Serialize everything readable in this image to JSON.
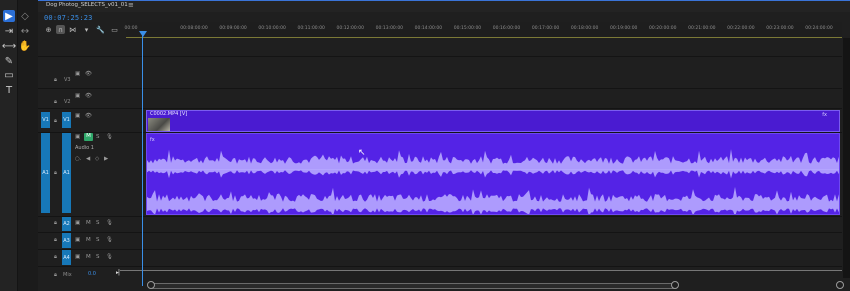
{
  "sequence_tab": {
    "title": "Dog Photog_SELECTS_v01_01",
    "menu_icon": "hamburger-menu-icon"
  },
  "timecode": "00:07:25:23",
  "ruler": {
    "ticks": [
      "00:00",
      "00:08:00:00",
      "00:09:00:00",
      "00:10:00:00",
      "00:11:00:00",
      "00:12:00:00",
      "00:13:00:00",
      "00:14:00:00",
      "00:15:00:00",
      "00:16:00:00",
      "00:17:00:00",
      "00:18:00:00",
      "00:19:00:00",
      "00:20:00:00",
      "00:21:00:00",
      "00:22:00:00",
      "00:23:00:00",
      "00:24:00:00"
    ]
  },
  "tracks": {
    "v3": {
      "label": "V3"
    },
    "v2": {
      "label": "V2"
    },
    "v1": {
      "label": "V1",
      "source": "V1"
    },
    "a1": {
      "label": "A1",
      "source": "A1",
      "name": "Audio 1",
      "mute": "M",
      "solo": "S"
    },
    "a2": {
      "label": "A2",
      "mute": "M",
      "solo": "S"
    },
    "a3": {
      "label": "A3",
      "mute": "M",
      "solo": "S"
    },
    "a4": {
      "label": "A4",
      "mute": "M",
      "solo": "S"
    },
    "mix": {
      "label": "Mix",
      "value": "0.0"
    }
  },
  "clips": {
    "video": {
      "label": "C0002.MP4 [V]",
      "fx": "fx"
    },
    "audio": {
      "fx": "fx"
    }
  },
  "colors": {
    "accent": "#3a8fe8",
    "clip_video": "#4a1bd1",
    "clip_audio": "#5423e6",
    "target": "#1778b8",
    "active_mute": "#2fa86a"
  }
}
